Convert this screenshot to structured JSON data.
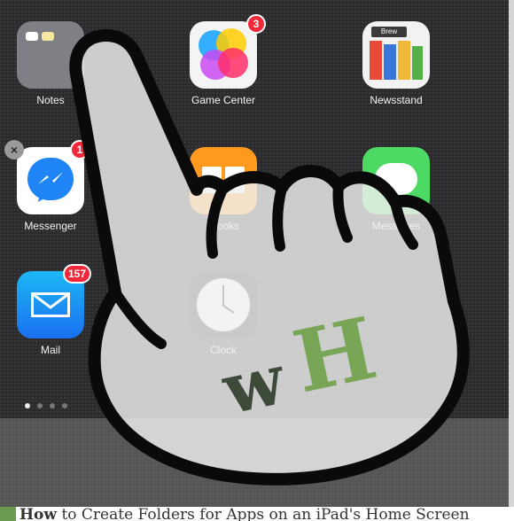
{
  "apps": [
    {
      "name": "Notes",
      "badge": null
    },
    {
      "name": "Game Center",
      "badge": "3"
    },
    {
      "name": "Newsstand",
      "badge": null
    },
    {
      "name": "Messenger",
      "badge": "1",
      "delete_mark": "×"
    },
    {
      "name": "iBooks",
      "badge": null
    },
    {
      "name": "Messages",
      "badge": null
    },
    {
      "name": "Mail",
      "badge": "157"
    },
    {
      "name": "Clock",
      "badge": null
    }
  ],
  "watermark": {
    "w": "w",
    "h": "H",
    "colors": {
      "w": "#3d4a3a",
      "h": "#78a556"
    }
  },
  "newsstand_sign": "Brew",
  "caption": {
    "lead": "How",
    "rest": " to Create Folders for Apps on an iPad's Home Screen"
  },
  "page_indicator": {
    "pages": 4,
    "active": 1
  },
  "colors": {
    "background": "#2b2b2d",
    "badge": "#f0283a",
    "hand_fill": "#e8e8e8",
    "hand_outline": "#0a0a0a"
  }
}
